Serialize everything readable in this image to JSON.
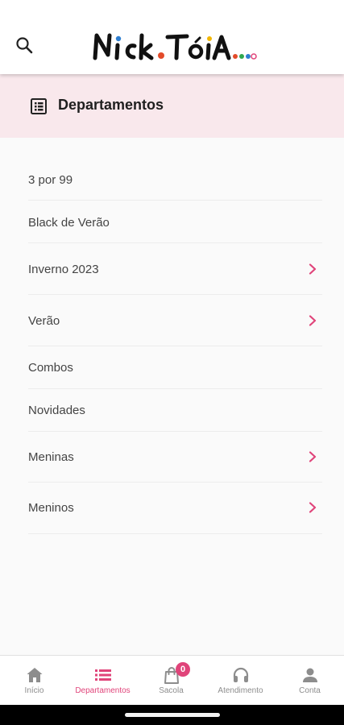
{
  "header": {
    "logo_text": "NICK.TÓIA..."
  },
  "section": {
    "title": "Departamentos"
  },
  "departments": [
    {
      "label": "3 por 99",
      "has_children": false
    },
    {
      "label": "Black de Verão",
      "has_children": false
    },
    {
      "label": "Inverno 2023",
      "has_children": true
    },
    {
      "label": "Verão",
      "has_children": true
    },
    {
      "label": "Combos",
      "has_children": false
    },
    {
      "label": "Novidades",
      "has_children": false
    },
    {
      "label": "Meninas",
      "has_children": true
    },
    {
      "label": "Meninos",
      "has_children": true
    }
  ],
  "bottom_nav": {
    "items": [
      {
        "label": "Início",
        "icon": "home-icon"
      },
      {
        "label": "Departamentos",
        "icon": "list-icon",
        "active": true
      },
      {
        "label": "Sacola",
        "icon": "bag-icon",
        "badge": "0"
      },
      {
        "label": "Atendimento",
        "icon": "headset-icon"
      },
      {
        "label": "Conta",
        "icon": "person-icon"
      }
    ]
  },
  "colors": {
    "accent": "#e0447a",
    "header_bg": "#f9e8ec",
    "inactive": "#8d8d8d"
  }
}
